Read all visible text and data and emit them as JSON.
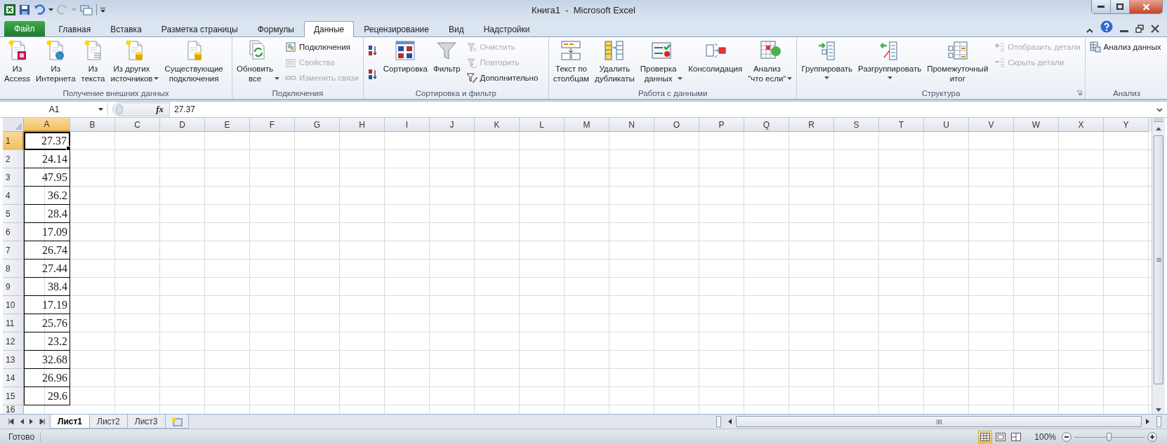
{
  "window": {
    "title": "Книга1  -  Microsoft Excel"
  },
  "file_tab": "Файл",
  "tabs": [
    {
      "label": "Главная",
      "selected": false
    },
    {
      "label": "Вставка",
      "selected": false
    },
    {
      "label": "Разметка страницы",
      "selected": false
    },
    {
      "label": "Формулы",
      "selected": false
    },
    {
      "label": "Данные",
      "selected": true
    },
    {
      "label": "Рецензирование",
      "selected": false
    },
    {
      "label": "Вид",
      "selected": false
    },
    {
      "label": "Надстройки",
      "selected": false
    }
  ],
  "ribbon_groups": [
    {
      "label": "Получение внешних данных",
      "items": [
        {
          "kind": "large",
          "label": "Из\nAccess"
        },
        {
          "kind": "large",
          "label": "Из\nИнтернета"
        },
        {
          "kind": "large",
          "label": "Из\nтекста"
        },
        {
          "kind": "large",
          "label": "Из других\nисточников",
          "dropdown": true
        },
        {
          "kind": "large",
          "label": "Существующие\nподключения"
        }
      ]
    },
    {
      "label": "Подключения",
      "items": [
        {
          "kind": "large",
          "label": "Обновить\nвсе",
          "dropdown": true
        },
        {
          "kind": "stack",
          "items": [
            {
              "label": "Подключения",
              "disabled": false
            },
            {
              "label": "Свойства",
              "disabled": true
            },
            {
              "label": "Изменить связи",
              "disabled": true
            }
          ]
        }
      ]
    },
    {
      "label": "Сортировка и фильтр",
      "items": [
        {
          "kind": "sort_pair"
        },
        {
          "kind": "large",
          "label": "Сортировка"
        },
        {
          "kind": "large",
          "label": "Фильтр"
        },
        {
          "kind": "stack",
          "items": [
            {
              "label": "Очистить",
              "disabled": true
            },
            {
              "label": "Повторить",
              "disabled": true
            },
            {
              "label": "Дополнительно",
              "disabled": false
            }
          ]
        }
      ]
    },
    {
      "label": "Работа с данными",
      "items": [
        {
          "kind": "large",
          "label": "Текст по\nстолбцам"
        },
        {
          "kind": "large",
          "label": "Удалить\nдубликаты"
        },
        {
          "kind": "large",
          "label": "Проверка\nданных",
          "dropdown": true
        },
        {
          "kind": "large",
          "label": "Консолидация"
        },
        {
          "kind": "large",
          "label": "Анализ\n\"что если\"",
          "dropdown": true
        }
      ]
    },
    {
      "label": "Структура",
      "launcher": true,
      "items": [
        {
          "kind": "large",
          "label": "Группировать",
          "dropdown": true
        },
        {
          "kind": "large",
          "label": "Разгруппировать",
          "dropdown": true
        },
        {
          "kind": "large",
          "label": "Промежуточный\nитог"
        },
        {
          "kind": "stack",
          "items": [
            {
              "label": "Отобразить детали",
              "disabled": true
            },
            {
              "label": "Скрыть детали",
              "disabled": true
            }
          ]
        }
      ]
    },
    {
      "label": "Анализ",
      "items": [
        {
          "kind": "stack",
          "items": [
            {
              "label": "Анализ данных",
              "disabled": false
            }
          ]
        }
      ]
    }
  ],
  "formula_bar": {
    "name_box": "A1",
    "function_button": "fx",
    "value": "27.37"
  },
  "sheet": {
    "columns": [
      {
        "label": "A",
        "selected": true
      },
      {
        "label": "B",
        "selected": false
      },
      {
        "label": "C",
        "selected": false
      },
      {
        "label": "D",
        "selected": false
      },
      {
        "label": "E",
        "selected": false
      },
      {
        "label": "F",
        "selected": false
      },
      {
        "label": "G",
        "selected": false
      },
      {
        "label": "H",
        "selected": false
      },
      {
        "label": "I",
        "selected": false
      },
      {
        "label": "J",
        "selected": false
      },
      {
        "label": "K",
        "selected": false
      },
      {
        "label": "L",
        "selected": false
      },
      {
        "label": "M",
        "selected": false
      },
      {
        "label": "N",
        "selected": false
      },
      {
        "label": "O",
        "selected": false
      },
      {
        "label": "P",
        "selected": false
      },
      {
        "label": "Q",
        "selected": false
      },
      {
        "label": "R",
        "selected": false
      },
      {
        "label": "S",
        "selected": false
      },
      {
        "label": "T",
        "selected": false
      },
      {
        "label": "U",
        "selected": false
      },
      {
        "label": "V",
        "selected": false
      },
      {
        "label": "W",
        "selected": false
      },
      {
        "label": "X",
        "selected": false
      },
      {
        "label": "Y",
        "selected": false
      }
    ],
    "rows": [
      {
        "number": "1",
        "selected": true,
        "cells": [
          "27.37"
        ]
      },
      {
        "number": "2",
        "selected": false,
        "cells": [
          "24.14"
        ]
      },
      {
        "number": "3",
        "selected": false,
        "cells": [
          "47.95"
        ]
      },
      {
        "number": "4",
        "selected": false,
        "cells": [
          "36.2"
        ]
      },
      {
        "number": "5",
        "selected": false,
        "cells": [
          "28.4"
        ]
      },
      {
        "number": "6",
        "selected": false,
        "cells": [
          "17.09"
        ]
      },
      {
        "number": "7",
        "selected": false,
        "cells": [
          "26.74"
        ]
      },
      {
        "number": "8",
        "selected": false,
        "cells": [
          "27.44"
        ]
      },
      {
        "number": "9",
        "selected": false,
        "cells": [
          "38.4"
        ]
      },
      {
        "number": "10",
        "selected": false,
        "cells": [
          "17.19"
        ]
      },
      {
        "number": "11",
        "selected": false,
        "cells": [
          "25.76"
        ]
      },
      {
        "number": "12",
        "selected": false,
        "cells": [
          "23.2"
        ]
      },
      {
        "number": "13",
        "selected": false,
        "cells": [
          "32.68"
        ]
      },
      {
        "number": "14",
        "selected": false,
        "cells": [
          "26.96"
        ]
      },
      {
        "number": "15",
        "selected": false,
        "cells": [
          "29.6"
        ]
      },
      {
        "number": "16",
        "selected": false
      }
    ]
  },
  "sheet_tabs": [
    {
      "label": "Лист1",
      "selected": true
    },
    {
      "label": "Лист2",
      "selected": false
    },
    {
      "label": "Лист3",
      "selected": false
    }
  ],
  "status_bar": {
    "text": "Готово",
    "views": [
      {
        "selected": true
      },
      {
        "selected": false
      },
      {
        "selected": false
      }
    ],
    "zoom": "100%",
    "zoom_slider": {
      "level": 0.5
    }
  }
}
